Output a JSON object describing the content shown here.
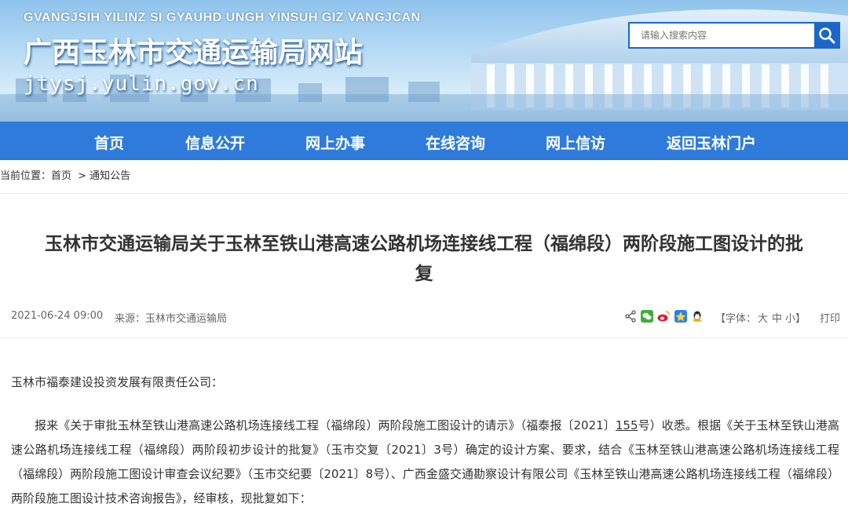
{
  "header": {
    "pinyin": "GVANGJSIH YILINZ SI GYAUHD UNGH YINSUH GIZ VANGJCAN",
    "site_name": "广西玉林市交通运输局网站",
    "domain": "jtysj.yulin.gov.cn"
  },
  "search": {
    "placeholder": "请输入搜索内容",
    "icon": "search-icon"
  },
  "nav": {
    "items": [
      "首页",
      "信息公开",
      "网上办事",
      "在线咨询",
      "网上信访",
      "返回玉林门户"
    ]
  },
  "breadcrumb": {
    "label": "当前位置：",
    "home": "首页",
    "sep": ">",
    "current": "通知公告"
  },
  "article": {
    "title_line1": "玉林市交通运输局关于玉林至铁山港高速公路机场连接线工程（福绵段）两阶段施工图设计的批",
    "title_line2": "复",
    "date": "2021-06-24 09:00",
    "source": "来源：玉林市交通运输局",
    "font_size_label": "【字体：",
    "font_big": "大",
    "font_mid": "中",
    "font_small": "小",
    "font_close": "】",
    "print": "打印",
    "share_icons": [
      "share-icon",
      "wechat-icon",
      "weibo-icon",
      "qzone-icon",
      "qq-icon"
    ],
    "recipient": "玉林市福泰建设投资发展有限责任公司：",
    "body_pre": "报来《关于审批玉林至铁山港高速公路机场连接线工程（福绵段）两阶段施工图设计的请示》（福泰报〔2021〕",
    "body_num": "155",
    "body_post": "号）收悉。根据《关于玉林至铁山港高速公路机场连接线工程（福绵段）两阶段初步设计的批复》（玉市交复〔2021〕3号）确定的设计方案、要求，结合《玉林至铁山港高速公路机场连接线工程（福绵段）两阶段施工图设计审查会议纪要》（玉市交纪要〔2021〕8号）、广西金盛交通勘察设计有限公司《玉林至铁山港高速公路机场连接线工程（福绵段）两阶段施工图设计技术咨询报告》，经审核，现批复如下："
  },
  "colors": {
    "nav_bg": "#2f7bdb",
    "search_accent": "#1b67c9"
  }
}
